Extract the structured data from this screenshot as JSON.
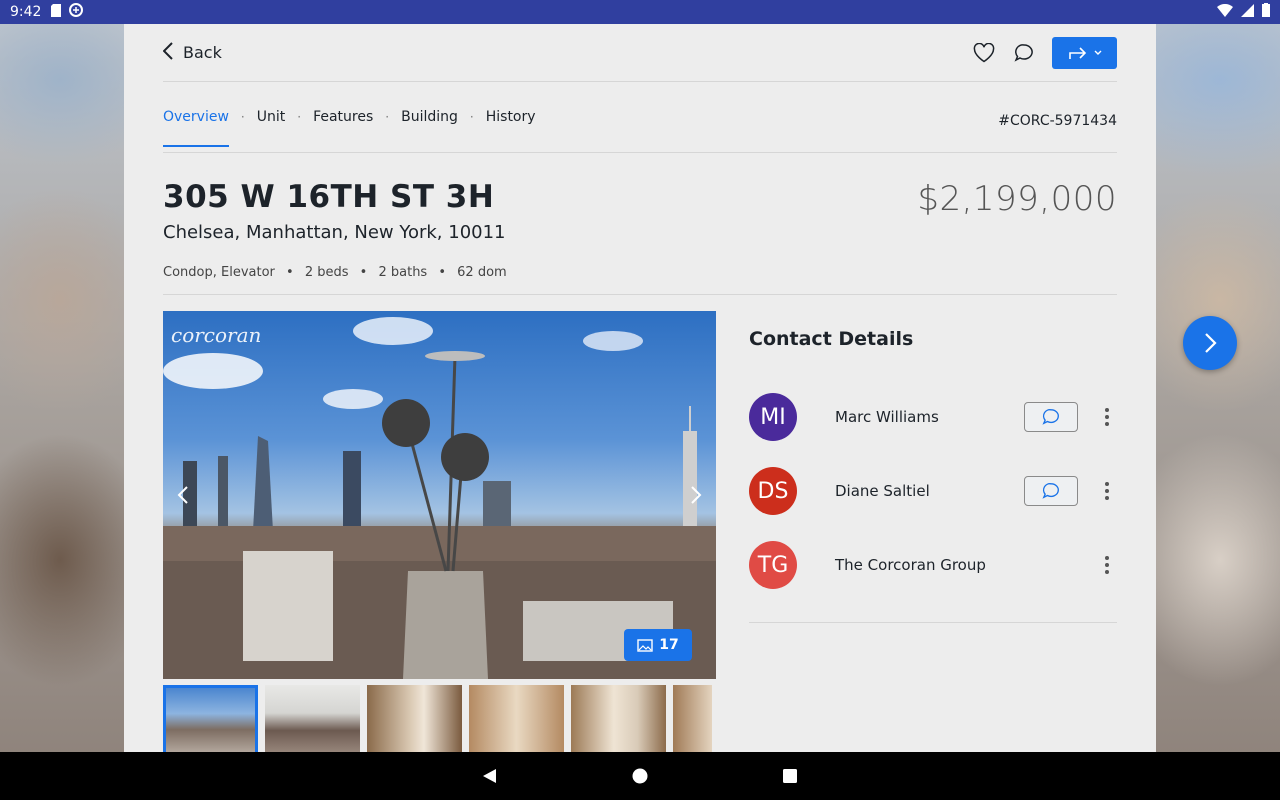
{
  "status_bar": {
    "time": "9:42"
  },
  "header": {
    "back_label": "Back"
  },
  "tabs": [
    {
      "label": "Overview",
      "active": true
    },
    {
      "label": "Unit"
    },
    {
      "label": "Features"
    },
    {
      "label": "Building"
    },
    {
      "label": "History"
    }
  ],
  "listing": {
    "id": "#CORC-5971434",
    "address": "305 W 16TH ST 3H",
    "neighborhood": "Chelsea, Manhattan, New York, 10011",
    "price": "$2,199,000",
    "type": "Condop, Elevator",
    "beds": "2 beds",
    "baths": "2 baths",
    "dom": "62 dom"
  },
  "gallery": {
    "watermark": "corcoran",
    "photo_count": "17"
  },
  "contact": {
    "title": "Contact Details",
    "people": [
      {
        "initials": "MI",
        "name": "Marc Williams",
        "color": "#4a2a9b"
      },
      {
        "initials": "DS",
        "name": "Diane Saltiel",
        "color": "#cc2e1c"
      },
      {
        "initials": "TG",
        "name": "The Corcoran Group",
        "color": "#e04b45"
      }
    ]
  },
  "colors": {
    "accent": "#1a73e8",
    "status_bar": "#303f9f"
  }
}
